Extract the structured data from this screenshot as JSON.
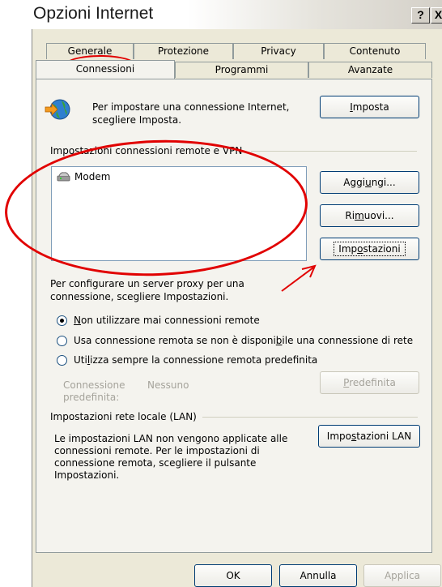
{
  "window": {
    "title": "Opzioni Internet",
    "help_label": "?",
    "close_label": "X"
  },
  "tabs_row1": [
    "Generale",
    "Protezione",
    "Privacy",
    "Contenuto"
  ],
  "tabs_row2": [
    "Connessioni",
    "Programmi",
    "Avanzate"
  ],
  "active_tab": "Connessioni",
  "setup": {
    "text_line1": "Per impostare una connessione Internet,",
    "text_line2": "scegliere Imposta.",
    "button_mn": "I",
    "button_rest": "mposta"
  },
  "dialup": {
    "group_label": "Impostazioni connessioni remote e VPN",
    "items": [
      "Modem"
    ],
    "add_button_a": "Aggi",
    "add_button_mn": "u",
    "add_button_b": "ngi...",
    "remove_button_a": "Ri",
    "remove_button_mn": "m",
    "remove_button_b": "uovi...",
    "settings_button_a": "Imp",
    "settings_button_mn": "o",
    "settings_button_b": "stazioni"
  },
  "proxy": {
    "text_line1": "Per configurare un server proxy per una",
    "text_line2": "connessione, scegliere Impostazioni."
  },
  "radios": [
    {
      "mn": "N",
      "rest": "on utilizzare mai connessioni remote",
      "checked": true
    },
    {
      "pre": "Usa connessione remota se non è disponi",
      "mn": "b",
      "post": "ile una connessione di rete",
      "checked": false
    },
    {
      "pre": "Uti",
      "mn": "l",
      "post": "izza sempre la connessione remota predefinita",
      "checked": false
    }
  ],
  "default_connection": {
    "label_line1": "Connessione",
    "label_line2": "predefinita:",
    "value": "Nessuno",
    "button_mn": "P",
    "button_rest": "redefinita"
  },
  "lan": {
    "group_label": "Impostazioni rete locale (LAN)",
    "text_lines": [
      "Le impostazioni LAN non vengono applicate alle",
      "connessioni remote. Per le impostazioni di",
      "connessione remota, scegliere il pulsante",
      "Impostazioni."
    ],
    "button_a": "Impo",
    "button_mn": "s",
    "button_b": "tazioni LAN"
  },
  "footer": {
    "ok_label": "OK",
    "cancel_label": "Annulla",
    "apply_label": "Applica"
  },
  "annotation_color": "#e10000"
}
